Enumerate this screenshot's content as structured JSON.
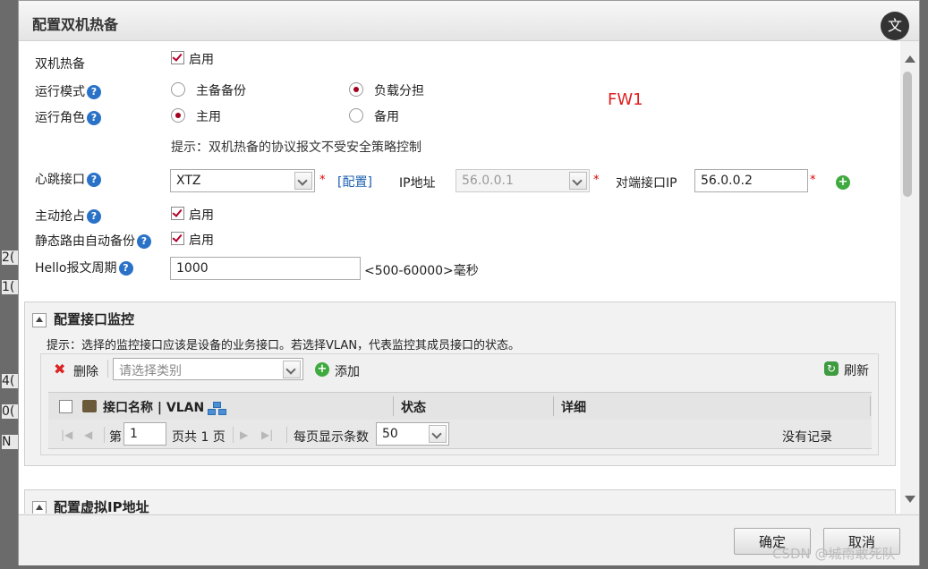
{
  "background": {
    "fragments": [
      "2(",
      "1(",
      "4(",
      "0(",
      "N"
    ]
  },
  "dialog": {
    "title": "配置双机热备",
    "close_glyph": "文",
    "annotation": "FW1"
  },
  "form": {
    "hot_standby": {
      "label": "双机热备",
      "checkbox_label": "启用",
      "checked": true
    },
    "run_mode": {
      "label": "运行模式",
      "options": [
        "主备备份",
        "负载分担"
      ],
      "selected": "负载分担"
    },
    "run_role": {
      "label": "运行角色",
      "options": [
        "主用",
        "备用"
      ],
      "selected": "主用"
    },
    "hint": "提示：双机热备的协议报文不受安全策略控制",
    "heartbeat": {
      "label": "心跳接口",
      "interface_value": "XTZ",
      "config_link": "[配置]",
      "ip_label": "IP地址",
      "ip_value": "56.0.0.1",
      "peer_label": "对端接口IP",
      "peer_value": "56.0.0.2",
      "required_mark": "*"
    },
    "preempt": {
      "label": "主动抢占",
      "checkbox_label": "启用",
      "checked": true
    },
    "static_route_backup": {
      "label": "静态路由自动备份",
      "checkbox_label": "启用",
      "checked": true
    },
    "hello": {
      "label": "Hello报文周期",
      "value": "1000",
      "range_hint": "<500-60000>毫秒"
    },
    "help_glyph": "?"
  },
  "monitor_section": {
    "title": "配置接口监控",
    "hint": "提示：选择的监控接口应该是设备的业务接口。若选择VLAN，代表监控其成员接口的状态。",
    "toolbar": {
      "delete_label": "删除",
      "category_placeholder": "请选择类别",
      "add_label": "添加",
      "refresh_label": "刷新"
    },
    "columns": [
      "接口名称 | VLAN",
      "状态",
      "详细"
    ],
    "pager": {
      "page_prefix": "第",
      "page_value": "1",
      "page_total": "页共 1 页",
      "per_page_label": "每页显示条数",
      "per_page_value": "50",
      "empty_text": "没有记录"
    }
  },
  "vip_section": {
    "title": "配置虚拟IP地址"
  },
  "footer": {
    "ok_label": "确定",
    "cancel_label": "取消"
  },
  "watermark": "CSDN @城南敢死队"
}
